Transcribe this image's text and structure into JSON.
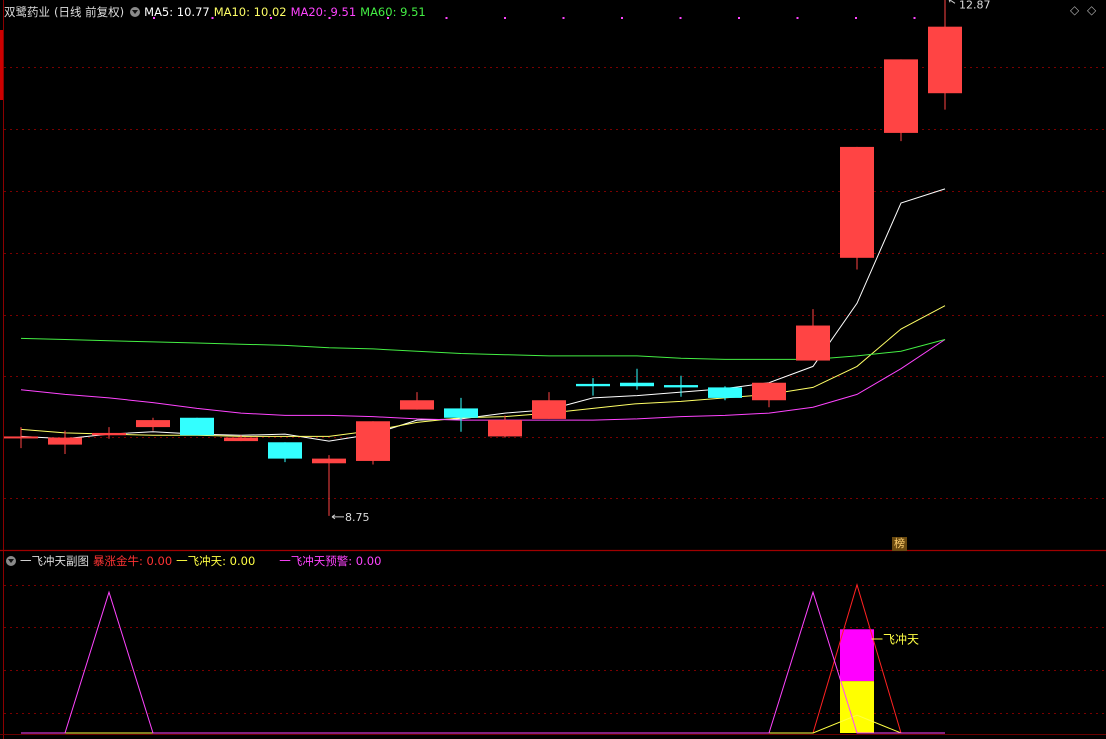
{
  "main_header": {
    "stock_name": "双鹭药业",
    "period": "(日线 前复权)",
    "ma5": {
      "label": "MA5: 10.77",
      "color": "#ffffff"
    },
    "ma10": {
      "label": "MA10: 10.02",
      "color": "#ffff66"
    },
    "ma20": {
      "label": "MA20: 9.51",
      "color": "#ff44ff"
    },
    "ma60": {
      "label": "MA60: 9.51",
      "color": "#44ee44"
    }
  },
  "sub_header": {
    "indicator": "一飞冲天副图",
    "baozhang": {
      "label": "暴涨金牛: 0.00",
      "color": "#ff3333"
    },
    "yifei": {
      "label": "一飞冲天: 0.00",
      "color": "#ffff44"
    },
    "yujing": {
      "label": "一飞冲天预警: 0.00",
      "color": "#ff44ff"
    }
  },
  "badge": "榜",
  "signal_label": "一飞冲天",
  "colors": {
    "up": "#ff4444",
    "down": "#33ffff",
    "grid": "#7a0000",
    "border": "#8b0000"
  },
  "chart_data": [
    {
      "type": "candlestick",
      "title": "双鹭药业",
      "y_range": [
        8.5,
        13.1
      ],
      "high_label": "12.87",
      "low_label": "8.75",
      "candles": [
        {
          "o": 9.43,
          "c": 9.43,
          "h": 9.51,
          "l": 9.33
        },
        {
          "o": 9.36,
          "c": 9.42,
          "h": 9.48,
          "l": 9.28
        },
        {
          "o": 9.44,
          "c": 9.46,
          "h": 9.51,
          "l": 9.41
        },
        {
          "o": 9.51,
          "c": 9.57,
          "h": 9.59,
          "l": 9.48
        },
        {
          "o": 9.59,
          "c": 9.44,
          "h": 9.59,
          "l": 9.44
        },
        {
          "o": 9.39,
          "c": 9.42,
          "h": 9.44,
          "l": 9.39
        },
        {
          "o": 9.38,
          "c": 9.24,
          "h": 9.38,
          "l": 9.21
        },
        {
          "o": 9.2,
          "c": 9.24,
          "h": 9.27,
          "l": 8.75
        },
        {
          "o": 9.22,
          "c": 9.56,
          "h": 9.56,
          "l": 9.19
        },
        {
          "o": 9.66,
          "c": 9.74,
          "h": 9.81,
          "l": 9.66
        },
        {
          "o": 9.67,
          "c": 9.59,
          "h": 9.76,
          "l": 9.47
        },
        {
          "o": 9.43,
          "c": 9.57,
          "h": 9.61,
          "l": 9.42
        },
        {
          "o": 9.58,
          "c": 9.74,
          "h": 9.81,
          "l": 9.58
        },
        {
          "o": 9.88,
          "c": 9.86,
          "h": 9.93,
          "l": 9.78
        },
        {
          "o": 9.89,
          "c": 9.86,
          "h": 10.01,
          "l": 9.83
        },
        {
          "o": 9.87,
          "c": 9.85,
          "h": 9.95,
          "l": 9.77
        },
        {
          "o": 9.85,
          "c": 9.76,
          "h": 9.86,
          "l": 9.74
        },
        {
          "o": 9.74,
          "c": 9.89,
          "h": 9.89,
          "l": 9.68
        },
        {
          "o": 10.08,
          "c": 10.38,
          "h": 10.52,
          "l": 10.08
        },
        {
          "o": 10.96,
          "c": 11.91,
          "h": 11.91,
          "l": 10.86
        },
        {
          "o": 12.03,
          "c": 12.66,
          "h": 12.66,
          "l": 11.96
        },
        {
          "o": 12.37,
          "c": 12.94,
          "h": 13.2,
          "l": 12.23
        }
      ],
      "ma": {
        "MA5": [
          9.43,
          9.41,
          9.45,
          9.47,
          9.45,
          9.44,
          9.45,
          9.39,
          9.45,
          9.57,
          9.58,
          9.63,
          9.66,
          9.76,
          9.78,
          9.81,
          9.84,
          9.89,
          10.03,
          10.57,
          11.43,
          11.55
        ],
        "MA10": [
          9.49,
          9.46,
          9.45,
          9.44,
          9.44,
          9.43,
          9.43,
          9.43,
          9.48,
          9.55,
          9.59,
          9.6,
          9.63,
          9.67,
          9.71,
          9.73,
          9.76,
          9.79,
          9.85,
          10.03,
          10.35,
          10.55
        ],
        "MA20": [
          9.83,
          9.79,
          9.76,
          9.72,
          9.67,
          9.63,
          9.61,
          9.61,
          9.6,
          9.58,
          9.57,
          9.57,
          9.57,
          9.57,
          9.58,
          9.6,
          9.61,
          9.63,
          9.68,
          9.79,
          10.01,
          10.26
        ],
        "MA60": [
          10.27,
          10.26,
          10.25,
          10.24,
          10.23,
          10.22,
          10.21,
          10.19,
          10.18,
          10.16,
          10.14,
          10.13,
          10.12,
          10.12,
          10.12,
          10.1,
          10.09,
          10.09,
          10.09,
          10.12,
          10.16,
          10.26
        ]
      }
    },
    {
      "type": "line",
      "title": "一飞冲天副图",
      "y_range": [
        0,
        1.1
      ],
      "series": [
        {
          "name": "暴涨金牛",
          "values": [
            0,
            0,
            0,
            0,
            0,
            0,
            0,
            0,
            0,
            0,
            0,
            0,
            0,
            0,
            0,
            0,
            0,
            0,
            0,
            1,
            0,
            0
          ]
        },
        {
          "name": "一飞冲天",
          "values": [
            0,
            0,
            0,
            0,
            0,
            0,
            0,
            0,
            0,
            0,
            0,
            0,
            0,
            0,
            0,
            0,
            0,
            0,
            0,
            0.12,
            0,
            0
          ]
        },
        {
          "name": "一飞冲天预警",
          "values": [
            0,
            0,
            0.95,
            0,
            0,
            0,
            0,
            0,
            0,
            0,
            0,
            0,
            0,
            0,
            0,
            0,
            0,
            0,
            0.95,
            0,
            0,
            0
          ]
        }
      ],
      "signal_bar": {
        "index": 19,
        "magenta_top": 0.7,
        "yellow_top": 0.35
      }
    }
  ]
}
